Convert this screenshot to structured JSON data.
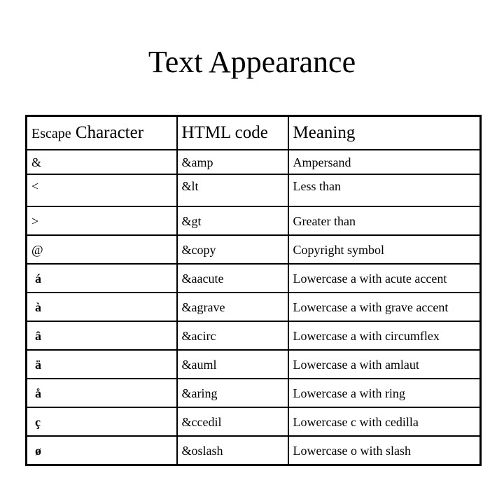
{
  "page": {
    "title": "Text Appearance"
  },
  "table": {
    "headers": {
      "escape_prefix": "Escape",
      "escape_suffix": " Character",
      "html_code": "HTML code",
      "meaning": "Meaning"
    },
    "rows": [
      {
        "char": "&",
        "code": "&amp",
        "meaning": "Ampersand"
      },
      {
        "char": "<",
        "code": "&lt",
        "meaning": "Less than"
      },
      {
        "char": ">",
        "code": "&gt",
        "meaning": "Greater than"
      },
      {
        "char": "@",
        "code": "&copy",
        "meaning": "Copyright symbol"
      },
      {
        "char": "á",
        "code": "&aacute",
        "meaning": "Lowercase a with acute accent"
      },
      {
        "char": "à",
        "code": "&agrave",
        "meaning": "Lowercase a with grave accent"
      },
      {
        "char": "â",
        "code": "&acirc",
        "meaning": "Lowercase a with circumflex"
      },
      {
        "char": "ä",
        "code": "&auml",
        "meaning": "Lowercase a with amlaut"
      },
      {
        "char": "å",
        "code": "&aring",
        "meaning": "Lowercase a with ring"
      },
      {
        "char": "ç",
        "code": "&ccedil",
        "meaning": "Lowercase c with cedilla"
      },
      {
        "char": "ø",
        "code": "&oslash",
        "meaning": "Lowercase o with slash"
      }
    ]
  }
}
